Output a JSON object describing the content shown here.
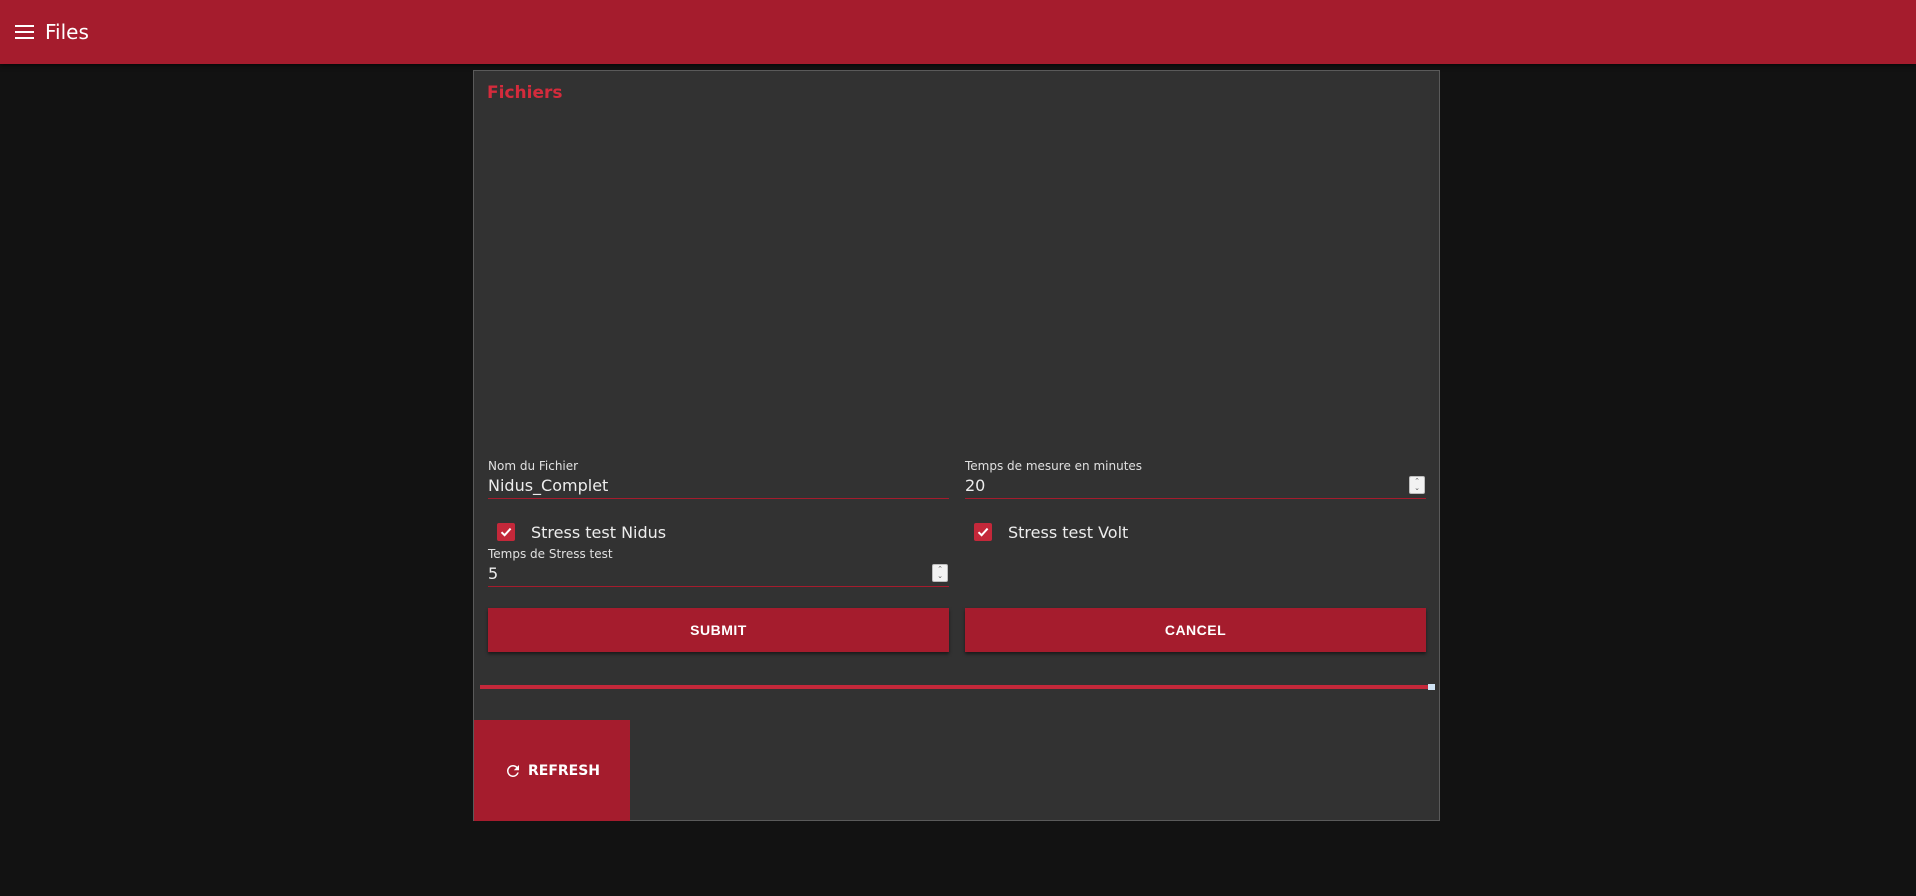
{
  "appbar": {
    "menu_icon": "menu-icon",
    "title": "Files"
  },
  "card": {
    "title": "Fichiers",
    "file_name": {
      "label": "Nom du Fichier",
      "value": "Nidus_Complet"
    },
    "measure_time": {
      "label": "Temps de mesure en minutes",
      "value": "20"
    },
    "stress_nidus": {
      "label": "Stress test Nidus",
      "checked": true
    },
    "stress_volt": {
      "label": "Stress test Volt",
      "checked": true
    },
    "stress_time": {
      "label": "Temps de Stress test",
      "value": "5"
    },
    "submit_label": "SUBMIT",
    "cancel_label": "CANCEL",
    "progress": 1.0,
    "refresh_label": "REFRESH",
    "refresh_icon": "refresh-icon"
  },
  "colors": {
    "primary": "#a51c2d",
    "accent": "#d42b3c",
    "background": "#121212",
    "surface": "#323232"
  }
}
